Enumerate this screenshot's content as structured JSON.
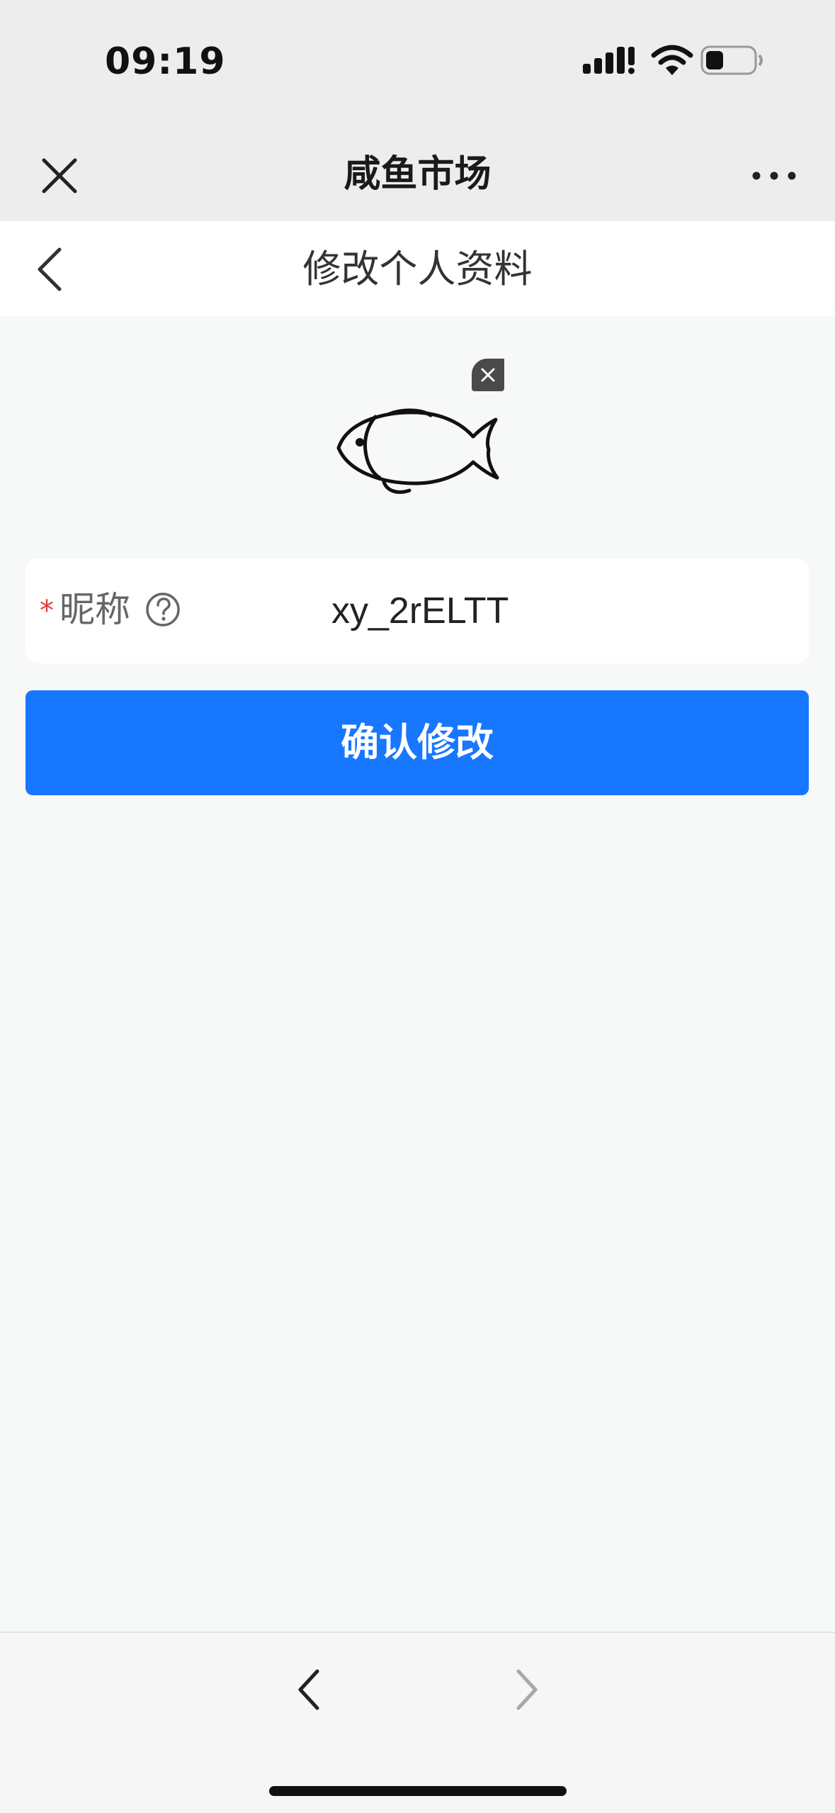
{
  "status_bar": {
    "time": "09:19",
    "icons": [
      "signal-icon",
      "wifi-icon",
      "battery-icon"
    ]
  },
  "app_nav": {
    "title": "咸鱼市场",
    "close_icon": "close-icon",
    "more_icon": "more-icon"
  },
  "page_header": {
    "title": "修改个人资料",
    "back_icon": "chevron-left-icon"
  },
  "avatar": {
    "icon": "fish-icon",
    "remove_icon": "close-icon"
  },
  "form": {
    "nickname": {
      "required_mark": "*",
      "label": "昵称",
      "help_icon": "question-icon",
      "value": "xy_2rELTT"
    }
  },
  "confirm_button": {
    "label": "确认修改",
    "color": "#1877ff"
  },
  "bottom_bar": {
    "back_icon": "chevron-left-icon",
    "forward_icon": "chevron-right-icon"
  },
  "colors": {
    "accent": "#1877ff",
    "required": "#e23a3a",
    "nav_background": "#ededed",
    "page_background": "#f7f8f8"
  }
}
